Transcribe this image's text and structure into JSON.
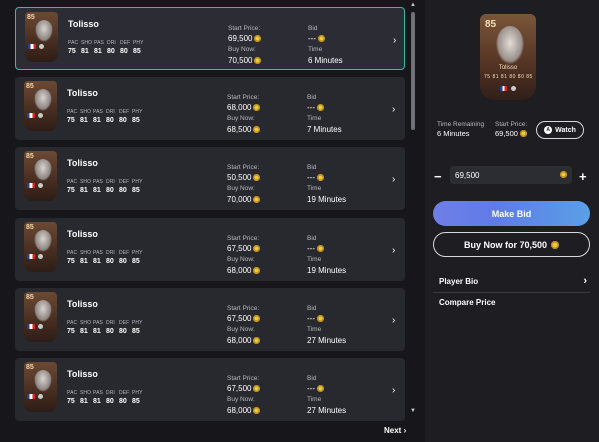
{
  "listings": [
    {
      "name": "Tolisso",
      "rating": "85",
      "stat_labels": [
        "PAC",
        "SHO",
        "PAS",
        "DRI",
        "DEF",
        "PHY"
      ],
      "stats": [
        "75",
        "81",
        "81",
        "80",
        "80",
        "85"
      ],
      "start_price_label": "Start Price:",
      "start_price": "69,500",
      "buy_now_label": "Buy Now:",
      "buy_now": "70,500",
      "bid_label": "Bid",
      "bid": "---",
      "time_label": "Time",
      "time": "6 Minutes"
    },
    {
      "name": "Tolisso",
      "rating": "85",
      "stat_labels": [
        "PAC",
        "SHO",
        "PAS",
        "DRI",
        "DEF",
        "PHY"
      ],
      "stats": [
        "75",
        "81",
        "81",
        "80",
        "80",
        "85"
      ],
      "start_price_label": "Start Price:",
      "start_price": "68,000",
      "buy_now_label": "Buy Now:",
      "buy_now": "68,500",
      "bid_label": "Bid",
      "bid": "---",
      "time_label": "Time",
      "time": "7 Minutes"
    },
    {
      "name": "Tolisso",
      "rating": "85",
      "stat_labels": [
        "PAC",
        "SHO",
        "PAS",
        "DRI",
        "DEF",
        "PHY"
      ],
      "stats": [
        "75",
        "81",
        "81",
        "80",
        "80",
        "85"
      ],
      "start_price_label": "Start Price:",
      "start_price": "50,500",
      "buy_now_label": "Buy Now:",
      "buy_now": "70,000",
      "bid_label": "Bid",
      "bid": "---",
      "time_label": "Time",
      "time": "19 Minutes"
    },
    {
      "name": "Tolisso",
      "rating": "85",
      "stat_labels": [
        "PAC",
        "SHO",
        "PAS",
        "DRI",
        "DEF",
        "PHY"
      ],
      "stats": [
        "75",
        "81",
        "81",
        "80",
        "80",
        "85"
      ],
      "start_price_label": "Start Price:",
      "start_price": "67,500",
      "buy_now_label": "Buy Now:",
      "buy_now": "68,000",
      "bid_label": "Bid",
      "bid": "---",
      "time_label": "Time",
      "time": "19 Minutes"
    },
    {
      "name": "Tolisso",
      "rating": "85",
      "stat_labels": [
        "PAC",
        "SHO",
        "PAS",
        "DRI",
        "DEF",
        "PHY"
      ],
      "stats": [
        "75",
        "81",
        "81",
        "80",
        "80",
        "85"
      ],
      "start_price_label": "Start Price:",
      "start_price": "67,500",
      "buy_now_label": "Buy Now:",
      "buy_now": "68,000",
      "bid_label": "Bid",
      "bid": "---",
      "time_label": "Time",
      "time": "27 Minutes"
    },
    {
      "name": "Tolisso",
      "rating": "85",
      "stat_labels": [
        "PAC",
        "SHO",
        "PAS",
        "DRI",
        "DEF",
        "PHY"
      ],
      "stats": [
        "75",
        "81",
        "81",
        "80",
        "80",
        "85"
      ],
      "start_price_label": "Start Price:",
      "start_price": "67,500",
      "buy_now_label": "Buy Now:",
      "buy_now": "68,000",
      "bid_label": "Bid",
      "bid": "---",
      "time_label": "Time",
      "time": "27 Minutes"
    }
  ],
  "pagination": {
    "next_label": "Next"
  },
  "detail": {
    "rating": "85",
    "name": "Tolisso",
    "card_stats": "75 81 81 80 80 85",
    "time_remaining_label": "Time Remaining",
    "time_remaining": "6 Minutes",
    "start_price_label": "Start Price:",
    "start_price": "69,500",
    "watch_label": "Watch",
    "bid_value": "69,500",
    "minus_label": "−",
    "plus_label": "+",
    "make_bid_label": "Make Bid",
    "buy_now_label": "Buy Now for 70,500",
    "menu": [
      {
        "label": "Player Bio",
        "chevron": "›"
      },
      {
        "label": "Compare Price",
        "chevron": ""
      }
    ]
  },
  "colors": {
    "accent": "#39b8ad",
    "coin": "#f2c83d",
    "button_gradient_start": "#6f7fe6",
    "button_gradient_end": "#5aa0e6"
  }
}
